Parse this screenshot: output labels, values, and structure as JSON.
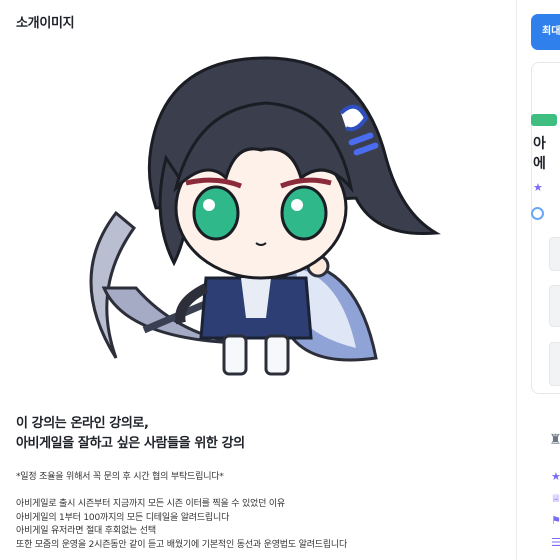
{
  "section": {
    "title": "소개이미지"
  },
  "intro": {
    "headline_line1": "이 강의는 온라인 강의로,",
    "headline_line2": "아비게일을 잘하고 싶은 사람들을 위한 강의",
    "note": "*일정 조율을 위해서 꼭 문의 후 시간 협의 부탁드립니다*",
    "lines": [
      "아비게일로 출시 시즌부터 지금까지 모든 시즌 이터를 찍을 수 있었던 이유",
      "아비게일의 1부터 100까지의 모든 디테일을 알려드립니다",
      "아비게일 유저라면 절대 후회없는 선택",
      "또한 모줌의 운영을 2시즌동안 같이 듣고 배웠기에 기본적인 동선과 운영법도 알려드립니다"
    ]
  },
  "sidebar": {
    "max_button": "최대",
    "card_title_line1": "아",
    "card_title_line2": "에",
    "icons": [
      "star-icon",
      "globe-icon",
      "instructor-icon",
      "crown-icon",
      "flag-icon"
    ]
  },
  "colors": {
    "accent": "#2f80ed",
    "badge": "#3fbf7f",
    "star": "#7b6cf6"
  }
}
